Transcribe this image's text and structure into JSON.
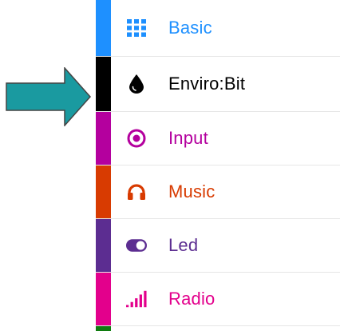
{
  "menu": {
    "items": [
      {
        "id": "basic",
        "label": "Basic",
        "color": "#1e90ff",
        "text_color": "#1e90ff",
        "icon": "grid-icon"
      },
      {
        "id": "enviro",
        "label": "Enviro:Bit",
        "color": "#000000",
        "text_color": "#000000",
        "icon": "droplet-icon"
      },
      {
        "id": "input",
        "label": "Input",
        "color": "#b4009e",
        "text_color": "#b4009e",
        "icon": "target-icon"
      },
      {
        "id": "music",
        "label": "Music",
        "color": "#d83b01",
        "text_color": "#d83b01",
        "icon": "headphones-icon"
      },
      {
        "id": "led",
        "label": "Led",
        "color": "#5c2d91",
        "text_color": "#5c2d91",
        "icon": "toggle-icon"
      },
      {
        "id": "radio",
        "label": "Radio",
        "color": "#e3008c",
        "text_color": "#e3008c",
        "icon": "signal-bars-icon"
      },
      {
        "id": "next",
        "label": "",
        "color": "#107c10",
        "text_color": "#107c10",
        "icon": ""
      }
    ]
  },
  "pointer": {
    "color": "#1a9aa0",
    "outline": "#444444",
    "icon": "arrow-right-icon"
  }
}
